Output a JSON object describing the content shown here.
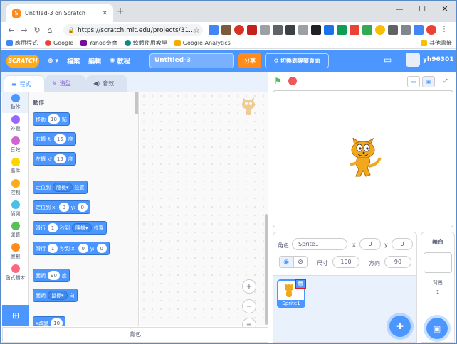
{
  "browser": {
    "tab_title": "Untitled-3 on Scratch",
    "url": "https://scratch.mit.edu/projects/31...",
    "bookmarks": [
      "應用程式",
      "Google",
      "Yahoo奇摩",
      "軟體使用教學",
      "Google Analytics"
    ],
    "other_bookmarks": "其他書籤"
  },
  "menu": {
    "logo": "SCRATCH",
    "file": "檔案",
    "edit": "編輯",
    "tutorials": "教程",
    "project_title": "Untitled-3",
    "share": "分享",
    "see_project": "切換到專案頁面",
    "username": "yh96301"
  },
  "editor_tabs": {
    "code": "程式",
    "costumes": "造型",
    "sounds": "音效"
  },
  "categories": [
    {
      "label": "動作",
      "color": "#4c97ff"
    },
    {
      "label": "外觀",
      "color": "#9966ff"
    },
    {
      "label": "音效",
      "color": "#cf63cf"
    },
    {
      "label": "事件",
      "color": "#ffd500"
    },
    {
      "label": "控制",
      "color": "#ffab19"
    },
    {
      "label": "偵測",
      "color": "#4cbfe6"
    },
    {
      "label": "運算",
      "color": "#59c059"
    },
    {
      "label": "變數",
      "color": "#ff8c1a"
    },
    {
      "label": "函式積木",
      "color": "#ff6680"
    }
  ],
  "palette": {
    "title": "動作",
    "blocks": {
      "move": {
        "pre": "移動",
        "v": "10",
        "post": "點"
      },
      "turn_right": {
        "pre": "右轉",
        "v": "15",
        "post": "度"
      },
      "turn_left": {
        "pre": "左轉",
        "v": "15",
        "post": "度"
      },
      "goto": {
        "pre": "定位到",
        "v": "隨機",
        "post": "位置"
      },
      "gotoxy": {
        "pre": "定位到 x:",
        "x": "0",
        "ymid": "y:",
        "y": "0"
      },
      "glide": {
        "pre": "滑行",
        "v": "1",
        "mid": "秒到",
        "dd": "隨機",
        "post": "位置"
      },
      "glidexy": {
        "pre": "滑行",
        "v": "1",
        "mid": "秒到 x:",
        "x": "0",
        "ymid": "y:",
        "y": "0"
      },
      "point": {
        "pre": "面朝",
        "v": "90",
        "post": "度"
      },
      "pointto": {
        "pre": "面朝",
        "dd": "鼠標",
        "post": "向"
      },
      "changex": {
        "pre": "x改變",
        "v": "10"
      }
    }
  },
  "code_area": {
    "zoom_in": "+",
    "zoom_out": "−",
    "zoom_reset": "="
  },
  "backpack": "背包",
  "sprite_info": {
    "sprite_label": "角色",
    "sprite_name": "Sprite1",
    "x_label": "x",
    "x": "0",
    "y_label": "y",
    "y": "0",
    "show_label": "顯示",
    "size_label": "尺寸",
    "size": "100",
    "direction_label": "方向",
    "direction": "90"
  },
  "sprite_list": {
    "sprite_name": "Sprite1"
  },
  "stage_panel": {
    "title": "舞台",
    "backdrops_label": "背景",
    "backdrops_count": "1"
  }
}
